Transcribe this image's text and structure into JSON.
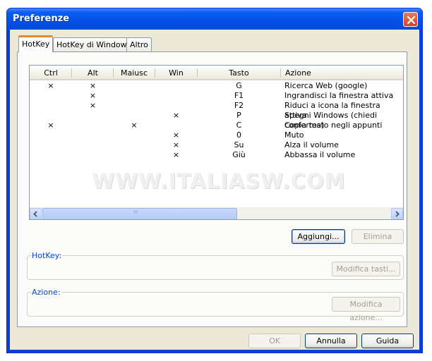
{
  "window": {
    "title": "Preferenze"
  },
  "tabs": [
    "HotKey",
    "HotKey di Windows",
    "Altro"
  ],
  "list": {
    "columns": [
      "Ctrl",
      "Alt",
      "Maiusc",
      "Win",
      "Tasto",
      "Azione"
    ],
    "rows": [
      {
        "ctrl": "×",
        "alt": "×",
        "maiusc": "",
        "win": "",
        "key": "G",
        "action": "Ricerca Web (google)"
      },
      {
        "ctrl": "",
        "alt": "×",
        "maiusc": "",
        "win": "",
        "key": "F1",
        "action": "Ingrandisci la finestra attiva"
      },
      {
        "ctrl": "",
        "alt": "×",
        "maiusc": "",
        "win": "",
        "key": "F2",
        "action": "Riduci a icona la finestra attiva"
      },
      {
        "ctrl": "",
        "alt": "",
        "maiusc": "",
        "win": "×",
        "key": "P",
        "action": "Spegni Windows (chiedi conferma)"
      },
      {
        "ctrl": "×",
        "alt": "",
        "maiusc": "×",
        "win": "",
        "key": "C",
        "action": "Copia testo negli appunti"
      },
      {
        "ctrl": "",
        "alt": "",
        "maiusc": "",
        "win": "×",
        "key": "0",
        "action": "Muto"
      },
      {
        "ctrl": "",
        "alt": "",
        "maiusc": "",
        "win": "×",
        "key": "Su",
        "action": "Alza il volume"
      },
      {
        "ctrl": "",
        "alt": "",
        "maiusc": "",
        "win": "×",
        "key": "Giù",
        "action": "Abbassa il volume"
      }
    ],
    "scroll_grip": "III"
  },
  "watermark": "WWW.ITALIASW.COM",
  "buttons": {
    "add": "Aggiungi...",
    "delete": "Elimina",
    "edit_keys": "Modifica tasti...",
    "edit_action": "Modifica azione...",
    "ok": "OK",
    "cancel": "Annulla",
    "help": "Guida"
  },
  "groups": {
    "hotkey": "HotKey:",
    "action": "Azione:"
  },
  "colors": {
    "title_bar": "#0450e6",
    "dialog_bg": "#ece9d8",
    "active_tab_accent": "#e68b2c",
    "group_label": "#0046d5"
  }
}
